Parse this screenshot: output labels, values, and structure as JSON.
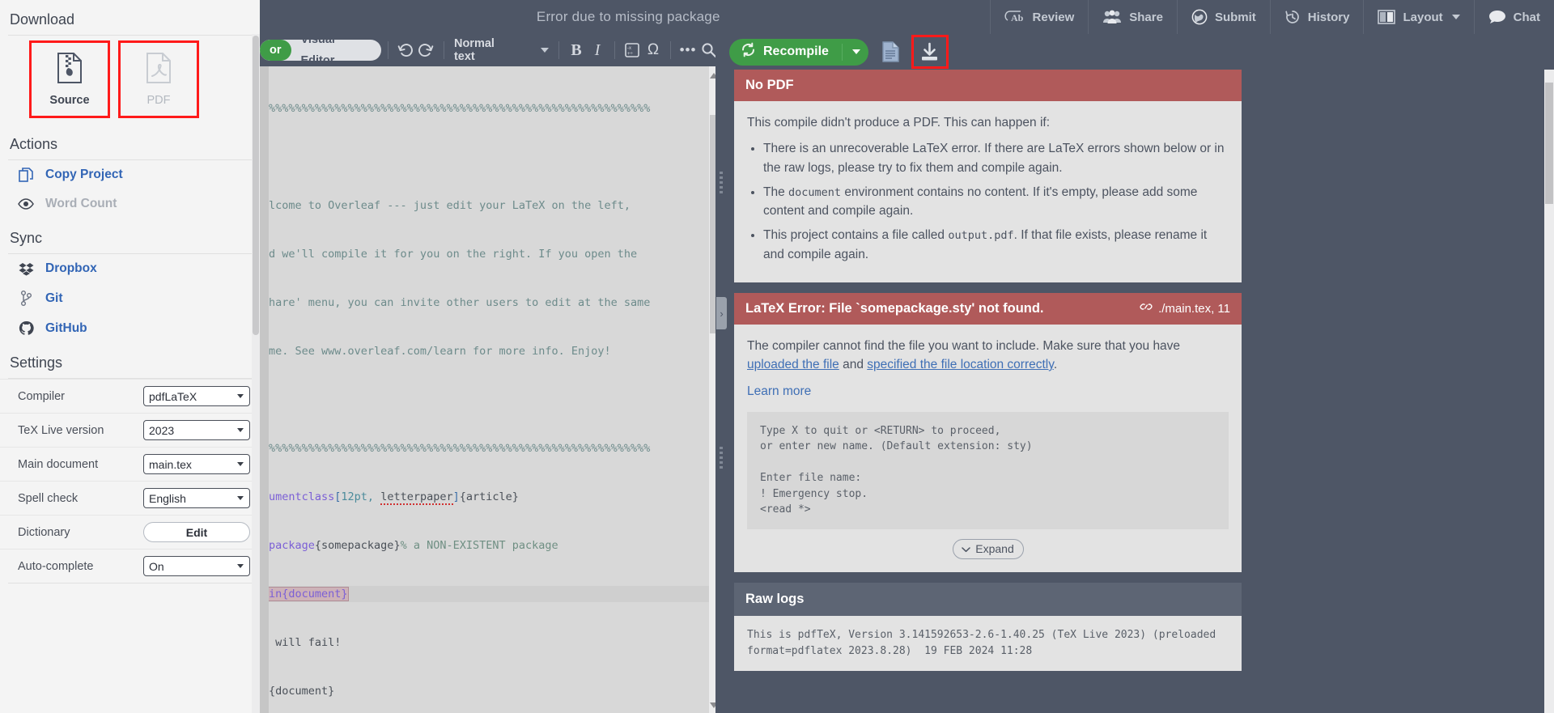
{
  "header": {
    "title": "Error due to missing package",
    "items": [
      {
        "label": "Review",
        "icon": "review-ab-icon"
      },
      {
        "label": "Share",
        "icon": "people-icon"
      },
      {
        "label": "Submit",
        "icon": "globe-icon"
      },
      {
        "label": "History",
        "icon": "history-clock-icon"
      },
      {
        "label": "Layout",
        "icon": "layout-columns-icon",
        "caret": true
      },
      {
        "label": "Chat",
        "icon": "chat-bubble-icon"
      }
    ]
  },
  "sidebar": {
    "download": {
      "title": "Download",
      "source": {
        "label": "Source",
        "icon": "zip-file-icon",
        "highlighted": true
      },
      "pdf": {
        "label": "PDF",
        "icon": "pdf-file-icon",
        "highlighted": true,
        "disabled": true
      }
    },
    "actions": {
      "title": "Actions",
      "items": [
        {
          "label": "Copy Project",
          "icon": "copy-icon",
          "enabled": true
        },
        {
          "label": "Word Count",
          "icon": "eye-icon",
          "enabled": false
        }
      ]
    },
    "sync": {
      "title": "Sync",
      "items": [
        {
          "label": "Dropbox",
          "icon": "dropbox-icon"
        },
        {
          "label": "Git",
          "icon": "git-branch-icon"
        },
        {
          "label": "GitHub",
          "icon": "github-icon"
        }
      ]
    },
    "settings": {
      "title": "Settings",
      "rows": [
        {
          "label": "Compiler",
          "value": "pdfLaTeX",
          "control": "select"
        },
        {
          "label": "TeX Live version",
          "value": "2023",
          "control": "select"
        },
        {
          "label": "Main document",
          "value": "main.tex",
          "control": "select"
        },
        {
          "label": "Spell check",
          "value": "English",
          "control": "select"
        },
        {
          "label": "Dictionary",
          "value": "Edit",
          "control": "button"
        },
        {
          "label": "Auto-complete",
          "value": "On",
          "control": "select"
        }
      ]
    }
  },
  "editor": {
    "mode": {
      "source_label": "or",
      "visual_label": "Visual Editor",
      "active": "Visual Editor"
    },
    "toolbar": {
      "undo": "undo-icon",
      "redo": "redo-icon",
      "style": "Normal text",
      "bold": "B",
      "italic": "I",
      "math": "math-icon",
      "omega": "Ω",
      "more": "•••",
      "search": "search-icon"
    },
    "code_lines": [
      {
        "text": "%%%%%%%%%%%%%%%%%%%%%%%%%%%%%%%%%%%%%%%%%%%%%%%%%%%%%%%%%%",
        "type": "comment"
      },
      {
        "text": "",
        "type": "blank"
      },
      {
        "text": "lcome to Overleaf --- just edit your LaTeX on the left,",
        "type": "comment"
      },
      {
        "text": "d we'll compile it for you on the right. If you open the",
        "type": "comment"
      },
      {
        "text": "hare' menu, you can invite other users to edit at the same",
        "type": "comment"
      },
      {
        "text": "me. See www.overleaf.com/learn for more info. Enjoy!",
        "type": "comment"
      },
      {
        "text": "",
        "type": "blank"
      },
      {
        "text": "%%%%%%%%%%%%%%%%%%%%%%%%%%%%%%%%%%%%%%%%%%%%%%%%%%%%%%%%%%",
        "type": "comment"
      },
      {
        "text": "umentclass[12pt, letterpaper]{article}",
        "type": "documentclass"
      },
      {
        "text": "package{somepackage}% a NON-EXISTENT package",
        "type": "usepackage"
      },
      {
        "text": "in{document}",
        "type": "begin-highlighted"
      },
      {
        "text": " will fail!",
        "type": "plain"
      },
      {
        "text": "{document}",
        "type": "end"
      }
    ],
    "code_tokens": {
      "documentclass_cmd": "umentclass",
      "documentclass_opts": "12pt, ",
      "documentclass_letterpaper": "letterpaper",
      "documentclass_arg": "{article}",
      "usepackage_cmd": "package",
      "usepackage_arg": "{somepackage}",
      "usepackage_comment": "% a NON-EXISTENT package",
      "begin_doc": "in{document}",
      "fail_text": " will fail!",
      "end_doc": "{document}"
    }
  },
  "pdf_panel": {
    "recompile": {
      "label": "Recompile",
      "icon": "recompile-sync-icon"
    },
    "file_icon": "log-file-icon",
    "download_icon": {
      "name": "download-icon",
      "highlighted": true
    },
    "no_pdf": {
      "title": "No PDF",
      "intro": "This compile didn't produce a PDF. This can happen if:",
      "bullets": [
        "There is an unrecoverable LaTeX error. If there are LaTeX errors shown below or in the raw logs, please try to fix them and compile again.",
        "The document environment contains no content. If it's empty, please add some content and compile again.",
        "This project contains a file called output.pdf. If that file exists, please rename it and compile again."
      ],
      "bullet2_mono": "document",
      "bullet3_mono": "output.pdf"
    },
    "latex_error": {
      "title": "LaTeX Error: File `somepackage.sty' not found.",
      "ref": "./main.tex, 11",
      "ref_icon": "link-icon",
      "body_before": "The compiler cannot find the file you want to include. Make sure that you have ",
      "link1": "uploaded the file",
      "body_mid": " and ",
      "link2": "specified the file location correctly",
      "body_after": ".",
      "learn_more": "Learn more",
      "log_excerpt": "Type X to quit or <RETURN> to proceed,\nor enter new name. (Default extension: sty)\n\nEnter file name: \n! Emergency stop.\n<read *>",
      "expand_label": "Expand"
    },
    "raw_logs": {
      "title": "Raw logs",
      "body": "This is pdfTeX, Version 3.141592653-2.6-1.40.25 (TeX Live 2023) (preloaded\nformat=pdflatex 2023.8.28)  19 FEB 2024 11:28"
    }
  }
}
